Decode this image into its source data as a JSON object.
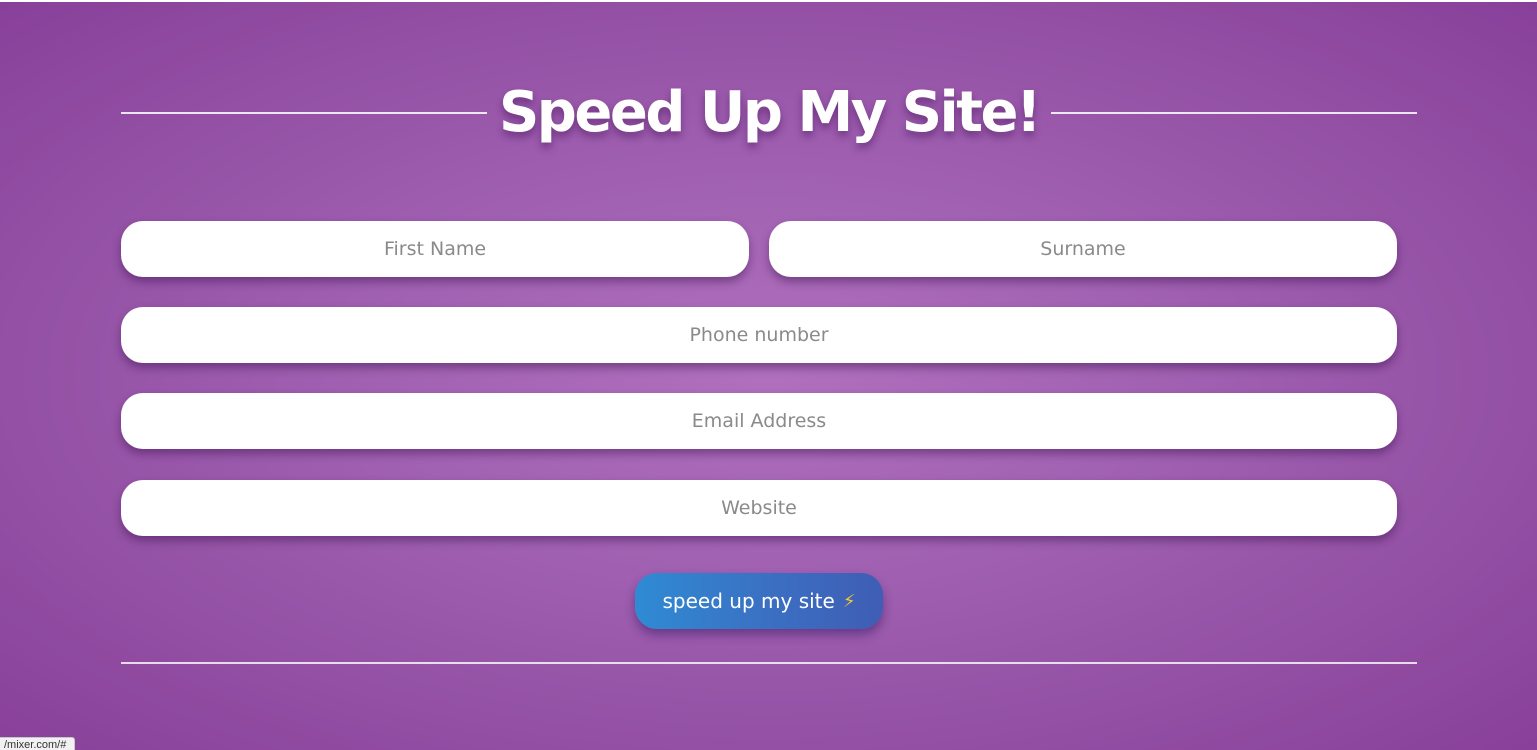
{
  "page": {
    "title": "Speed Up My Site!"
  },
  "form": {
    "first_name": {
      "placeholder": "First Name",
      "value": ""
    },
    "surname": {
      "placeholder": "Surname",
      "value": ""
    },
    "phone": {
      "placeholder": "Phone number",
      "value": ""
    },
    "email": {
      "placeholder": "Email Address",
      "value": ""
    },
    "website": {
      "placeholder": "Website",
      "value": ""
    },
    "submit": {
      "label": "speed up my site",
      "icon": "lightning-bolt-icon",
      "glyph": "⚡"
    }
  },
  "status_bar": {
    "url": "/mixer.com/#"
  },
  "colors": {
    "background_center": "#b070bd",
    "background_edge": "#88409a",
    "button_start": "#2f8bd4",
    "button_end": "#3f5db4",
    "bolt": "#f7c833"
  }
}
